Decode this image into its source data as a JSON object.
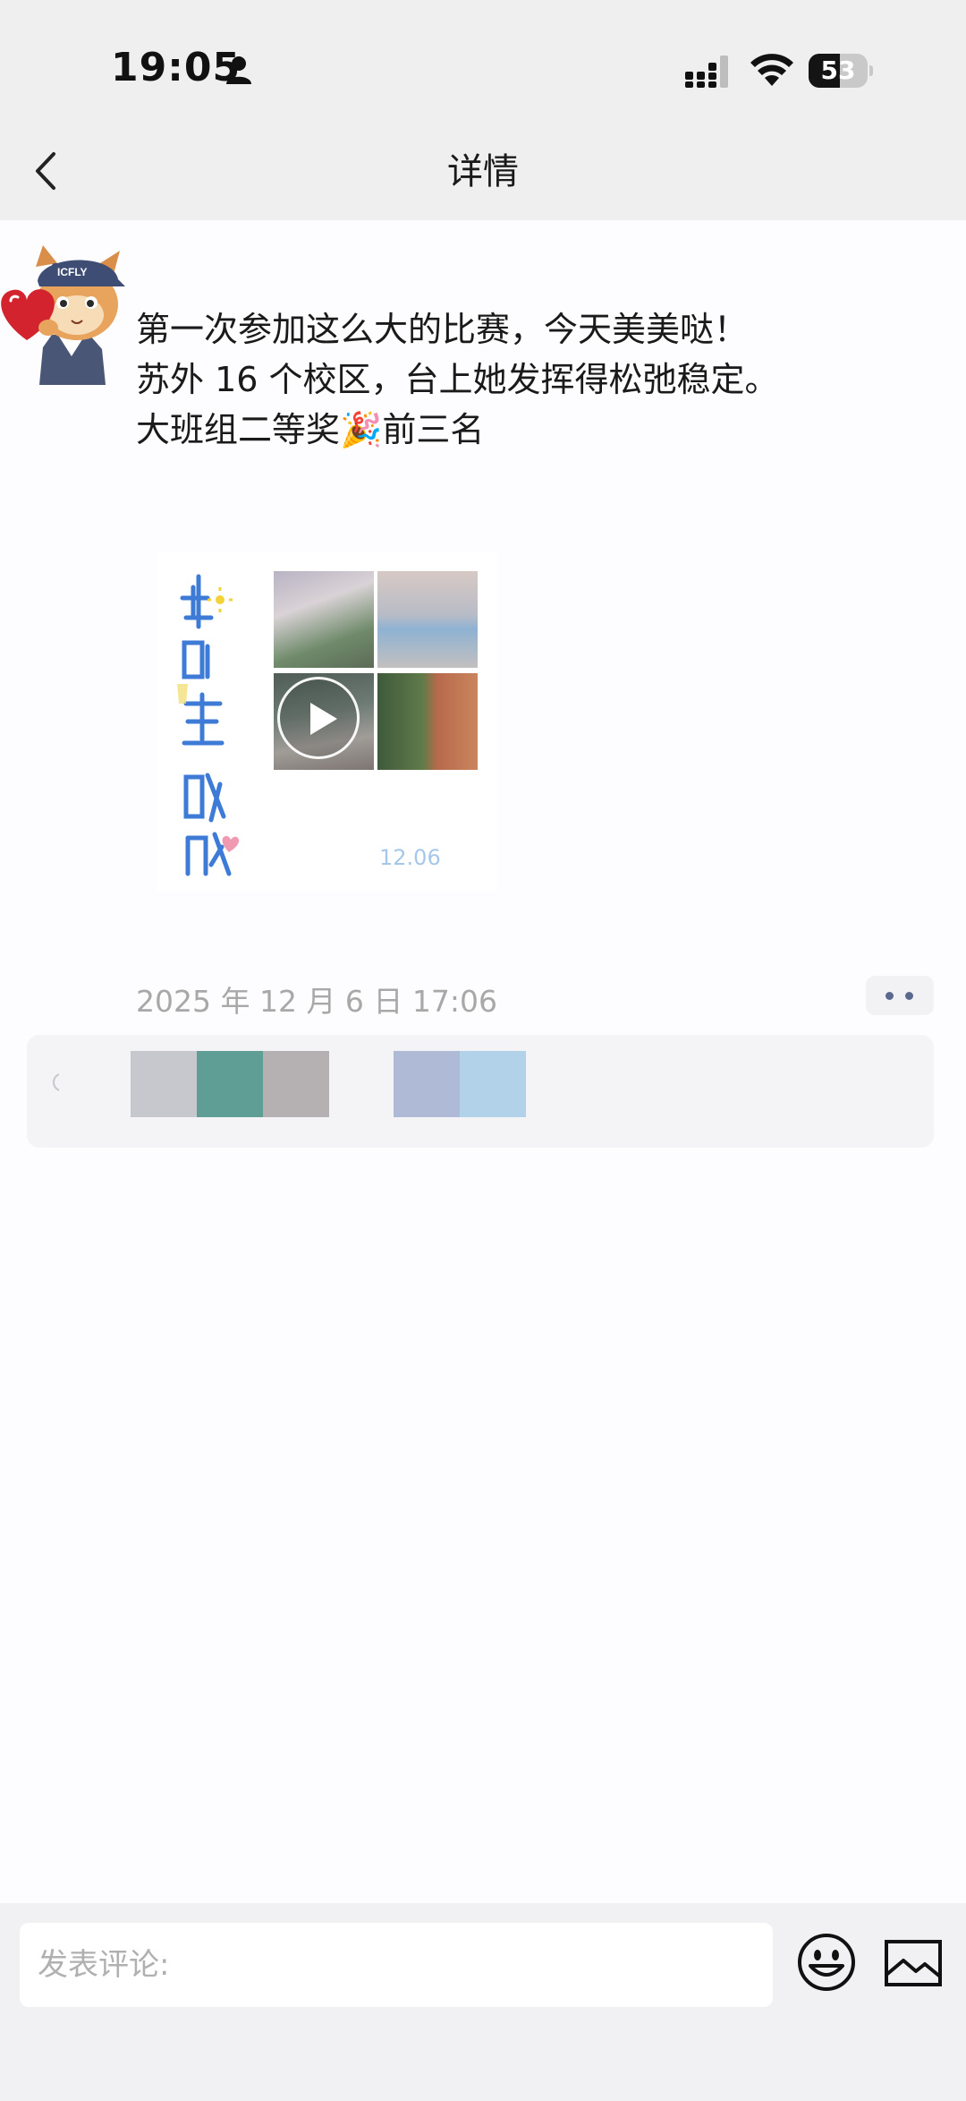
{
  "status_bar": {
    "time": "19:05",
    "battery_level": "53",
    "battery_fraction": 0.53
  },
  "header": {
    "title": "详情"
  },
  "post": {
    "text_lines": [
      "第一次参加这么大的比赛，今天美美哒！",
      "苏外 16 个校区，台上她发挥得松弛稳定。",
      "大班组二等奖🎉前三名"
    ],
    "video": {
      "date_overlay": "12.06"
    },
    "timestamp": "2025 年 12 月 6 日 17:06"
  },
  "likes": {
    "avatar_colors": [
      "#c6c8cd",
      "#5f9e94",
      "#b5b1b2",
      "#aebad6",
      "#b2d2ea"
    ]
  },
  "comment_bar": {
    "placeholder": "发表评论:"
  },
  "colors": {
    "header_bg": "#efefef",
    "page_bg": "#fdfcfe",
    "timestamp": "#a8a8a8",
    "accent_dots": "#5a6a8f"
  },
  "icons": [
    "person-icon",
    "signal-icon",
    "wifi-icon",
    "battery-icon",
    "back-arrow-icon",
    "play-icon",
    "more-dots-icon",
    "heart-icon",
    "emoji-icon",
    "image-icon"
  ]
}
